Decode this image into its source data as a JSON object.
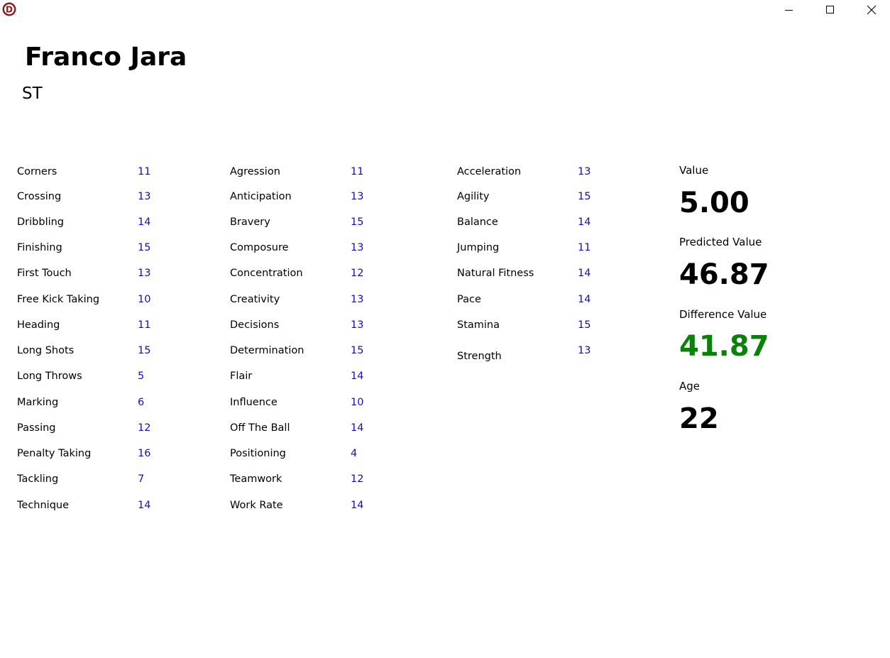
{
  "window": {
    "icon_letter": "D",
    "controls": [
      "minimize",
      "maximize",
      "close"
    ]
  },
  "player": {
    "name": "Franco Jara",
    "position": "ST"
  },
  "technical": [
    {
      "label": "Corners",
      "value": "11"
    },
    {
      "label": "Crossing",
      "value": "13"
    },
    {
      "label": "Dribbling",
      "value": "14"
    },
    {
      "label": "Finishing",
      "value": "15"
    },
    {
      "label": "First Touch",
      "value": "13"
    },
    {
      "label": "Free Kick Taking",
      "value": "10"
    },
    {
      "label": "Heading",
      "value": "11"
    },
    {
      "label": "Long Shots",
      "value": "15"
    },
    {
      "label": "Long Throws",
      "value": "5"
    },
    {
      "label": "Marking",
      "value": "6"
    },
    {
      "label": "Passing",
      "value": "12"
    },
    {
      "label": "Penalty Taking",
      "value": "16"
    },
    {
      "label": "Tackling",
      "value": "7"
    },
    {
      "label": "Technique",
      "value": "14"
    }
  ],
  "mental": [
    {
      "label": "Agression",
      "value": "11"
    },
    {
      "label": "Anticipation",
      "value": "13"
    },
    {
      "label": "Bravery",
      "value": "15"
    },
    {
      "label": "Composure",
      "value": "13"
    },
    {
      "label": "Concentration",
      "value": "12"
    },
    {
      "label": "Creativity",
      "value": "13"
    },
    {
      "label": "Decisions",
      "value": "13"
    },
    {
      "label": "Determination",
      "value": "15"
    },
    {
      "label": "Flair",
      "value": "14"
    },
    {
      "label": "Influence",
      "value": "10"
    },
    {
      "label": "Off The Ball",
      "value": "14"
    },
    {
      "label": "Positioning",
      "value": "4"
    },
    {
      "label": "Teamwork",
      "value": "12"
    },
    {
      "label": "Work Rate",
      "value": "14"
    }
  ],
  "physical": [
    {
      "label": "Acceleration",
      "value": "13"
    },
    {
      "label": "Agility",
      "value": "15"
    },
    {
      "label": "Balance",
      "value": "14"
    },
    {
      "label": "Jumping",
      "value": "11"
    },
    {
      "label": "Natural Fitness",
      "value": "14"
    },
    {
      "label": "Pace",
      "value": "14"
    },
    {
      "label": "Stamina",
      "value": "15"
    },
    {
      "label": "Strength",
      "value": "13"
    }
  ],
  "stats": {
    "value_label": "Value",
    "value": "5.00",
    "predicted_label": "Predicted Value",
    "predicted": "46.87",
    "difference_label": "Difference Value",
    "difference": "41.87",
    "age_label": "Age",
    "age": "22"
  },
  "colors": {
    "attribute_value": "#1010b8",
    "difference_value": "#0a820a",
    "icon_ring": "#8b1a1a"
  }
}
